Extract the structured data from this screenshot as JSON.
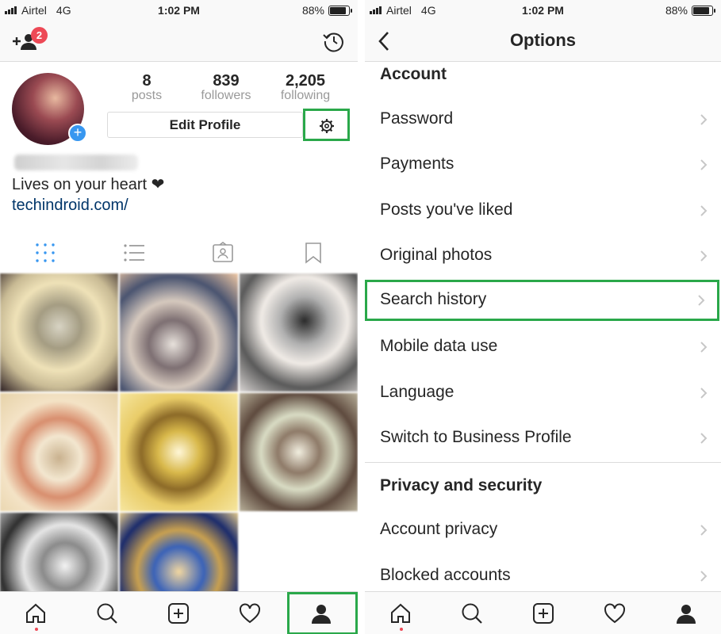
{
  "status": {
    "carrier": "Airtel",
    "network": "4G",
    "time": "1:02 PM",
    "battery": "88%",
    "battery_level": 0.88
  },
  "profile": {
    "notification_count": "2",
    "stats": [
      {
        "value": "8",
        "label": "posts"
      },
      {
        "value": "839",
        "label": "followers"
      },
      {
        "value": "2,205",
        "label": "following"
      }
    ],
    "edit_button": "Edit Profile",
    "bio": "Lives on your heart ❤",
    "website": "techindroid.com/"
  },
  "options": {
    "title": "Options",
    "account_section": "Account",
    "account_items": [
      "Password",
      "Payments",
      "Posts you've liked",
      "Original photos",
      "Search history",
      "Mobile data use",
      "Language",
      "Switch to Business Profile"
    ],
    "privacy_section": "Privacy and security",
    "privacy_items": [
      "Account privacy",
      "Blocked accounts"
    ]
  },
  "colors": {
    "highlight": "#2aa84a",
    "badge": "#ed4956",
    "link": "#003569",
    "accent": "#3897f0"
  }
}
